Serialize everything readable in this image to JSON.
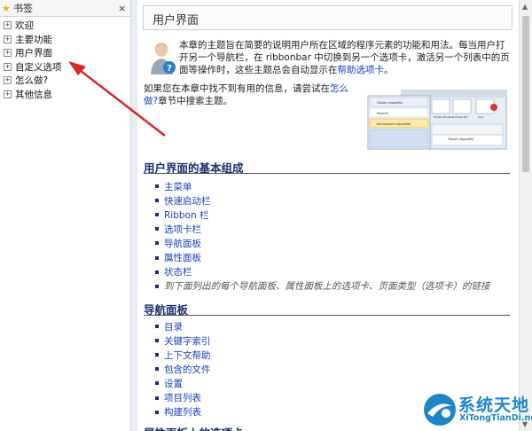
{
  "bookmarks": {
    "title": "书签",
    "close_glyph": "×",
    "items": [
      {
        "label": "欢迎"
      },
      {
        "label": "主要功能"
      },
      {
        "label": "用户界面"
      },
      {
        "label": "自定义选项"
      },
      {
        "label": "怎么做?"
      },
      {
        "label": "其他信息"
      }
    ]
  },
  "page": {
    "title": "用户界面",
    "intro": "本章的主题旨在简要的说明用户所在区域的程序元素的功能和用法。每当用户打开另一个导航栏，在 ribbonbar 中切换到另一个选项卡，激活另一个列表中的页面等操作时，这些主题总会自动显示在",
    "intro_link": "帮助选项卡",
    "intro_end": "。",
    "help_pre": "如果您在本章中找不到有用的信息，请尝试在",
    "help_link": "怎么做?",
    "help_post": "章节中搜索主题。",
    "screenshot_labels": {
      "row1": "Obsah nápovědy",
      "row2": "Rejstřík",
      "row3": "Kontextová nápověda",
      "tool1": "Přidat uživatelé",
      "tool2": "Přidat klíč",
      "tool3": "Ove",
      "row4": "Obsah nápovědy"
    }
  },
  "sections": [
    {
      "title": "用户界面的基本组成",
      "items": [
        "主菜单",
        "快速启动栏",
        "Ribbon 栏",
        "选项卡栏",
        "导航面板",
        "属性面板",
        "状态栏"
      ],
      "note": "到下面列出的每个导航面板、属性面板上的选项卡、页面类型（选项卡）的链接"
    },
    {
      "title": "导航面板",
      "items": [
        "目录",
        "关键字索引",
        "上下文帮助",
        "包含的文件",
        "设置",
        "项目列表",
        "构建列表"
      ]
    },
    {
      "title": "属性面板上的选项卡"
    }
  ],
  "watermark": {
    "name": "系统天地",
    "url": "XiTongTianDi.net"
  },
  "colors": {
    "accent": "#1b2f6b",
    "link": "#1a3fb8",
    "arrow": "#d9262a"
  }
}
